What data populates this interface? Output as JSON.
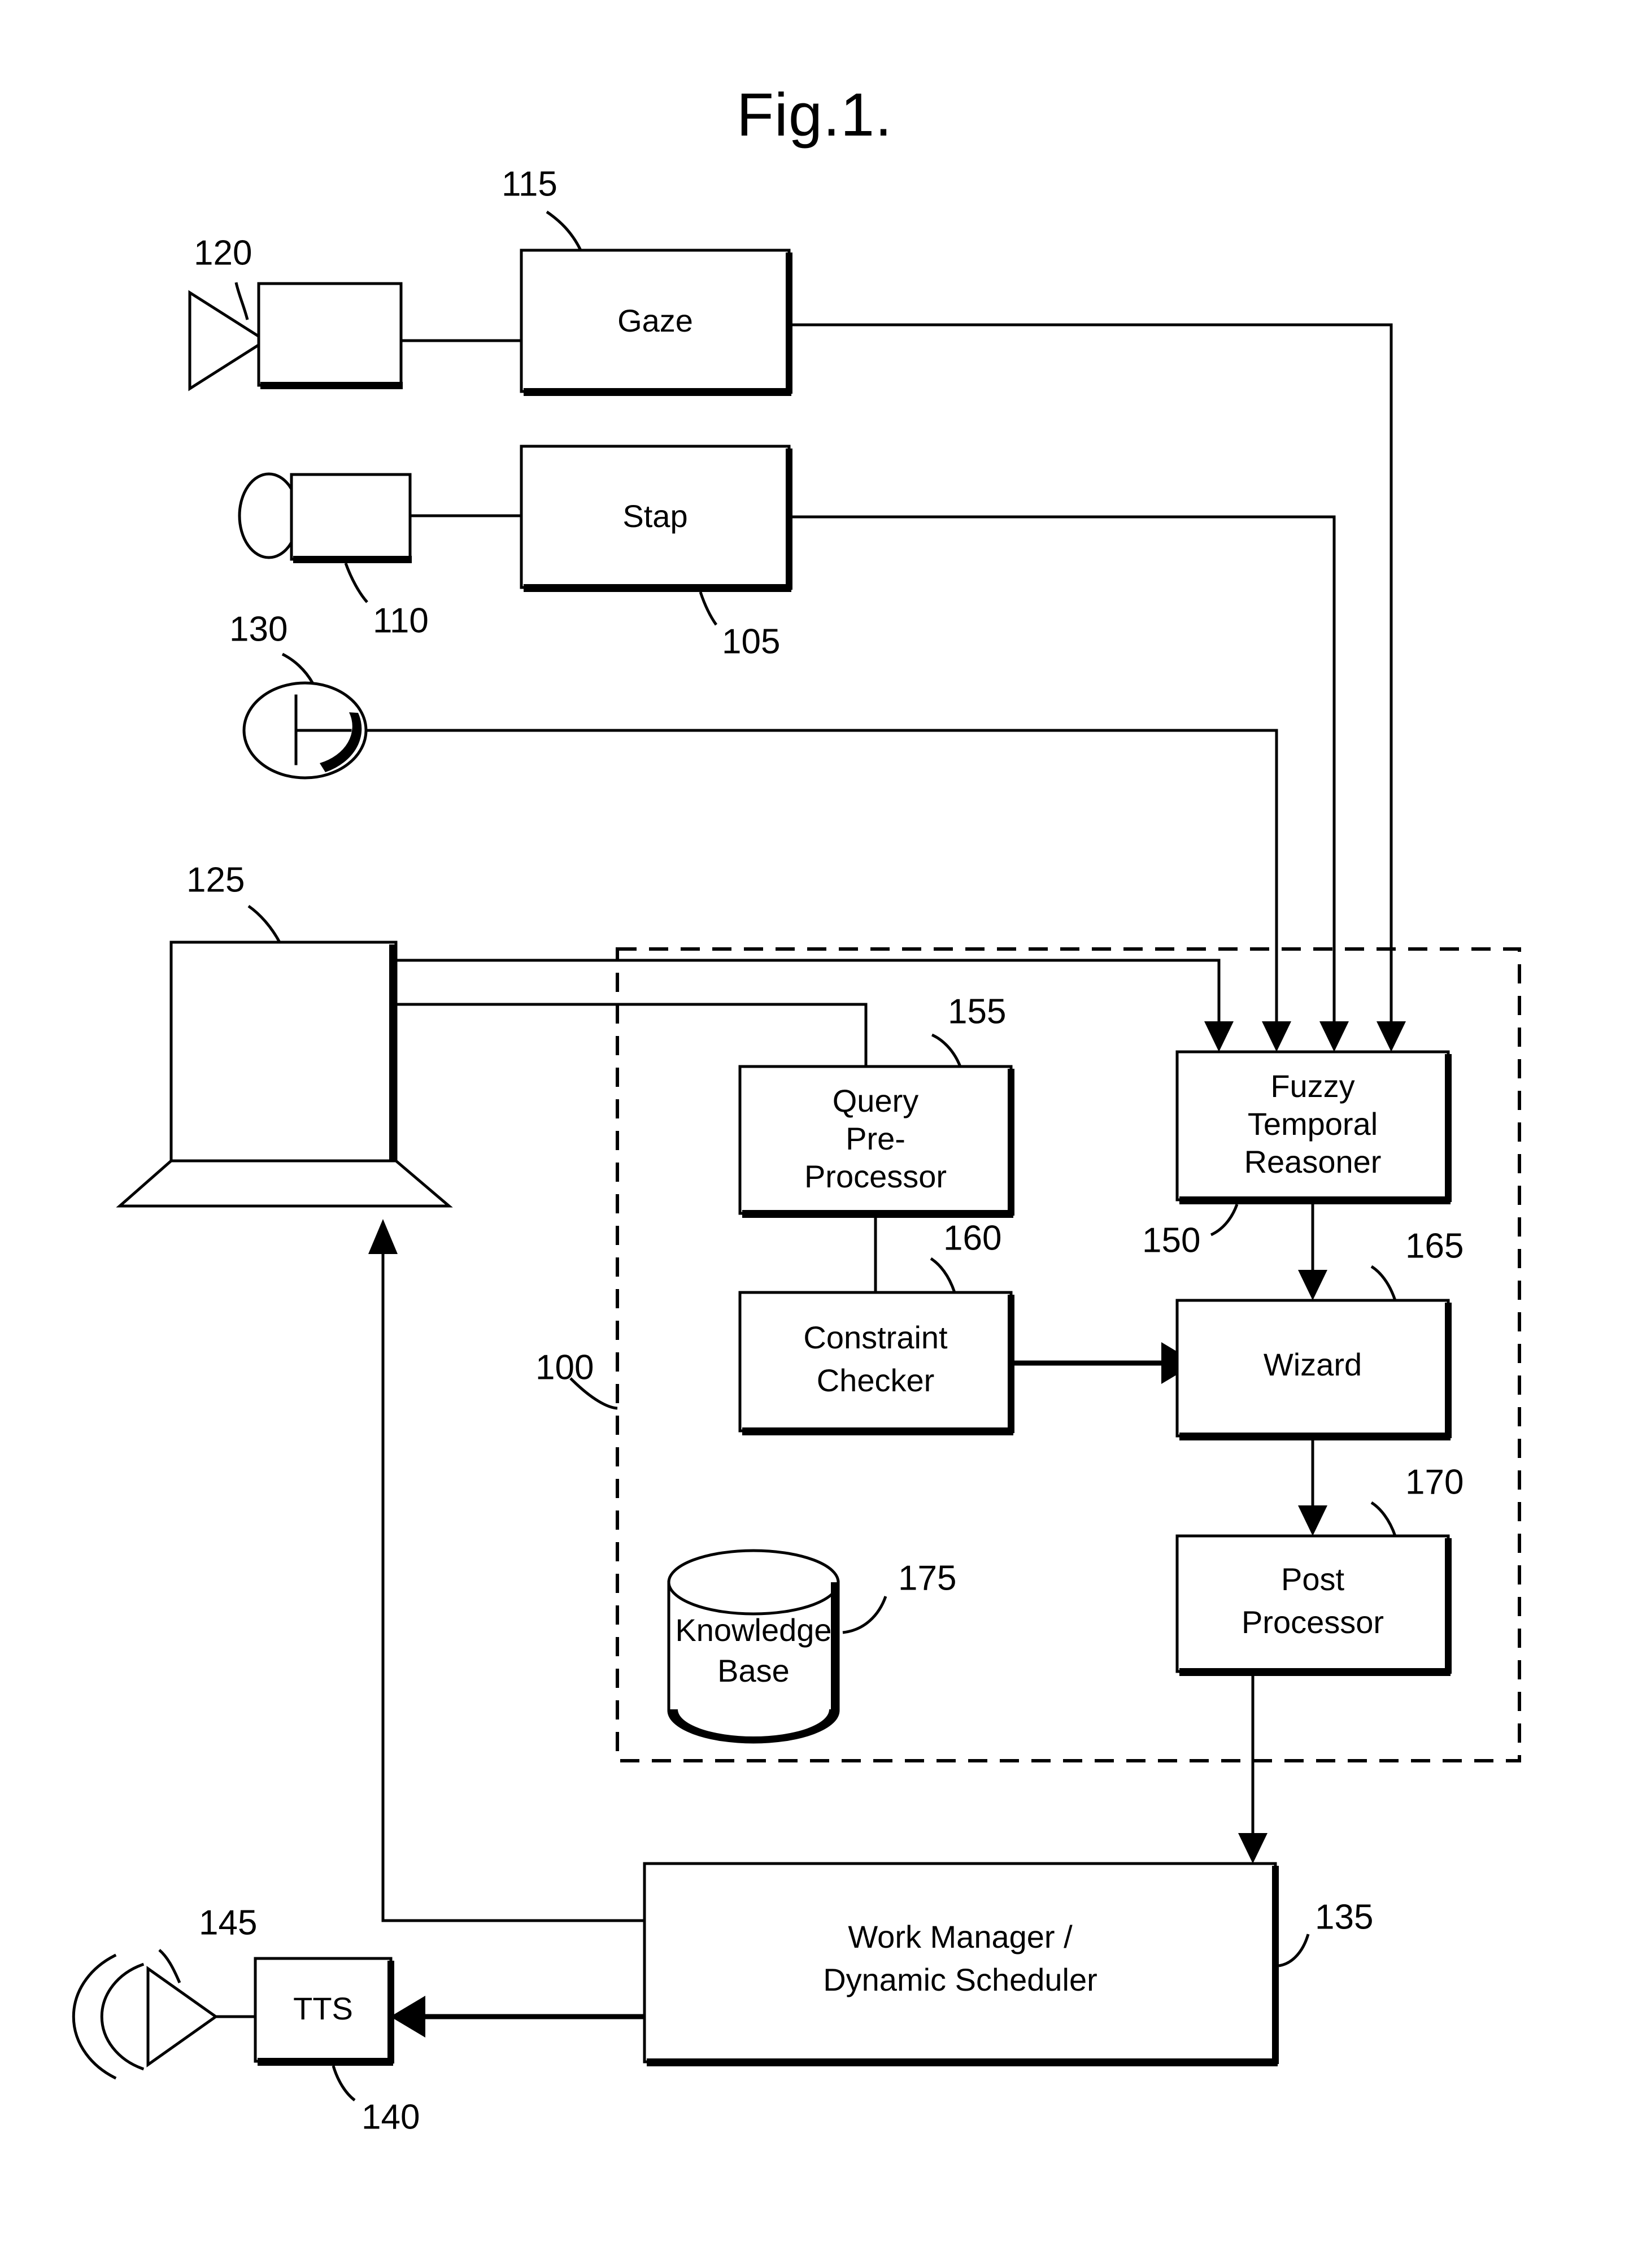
{
  "figure": {
    "title": "Fig.1.",
    "type": "patent-block-diagram"
  },
  "blocks": [
    {
      "id": "gaze",
      "label": "Gaze",
      "ref": "115"
    },
    {
      "id": "stap",
      "label": "Stap",
      "ref": "105"
    },
    {
      "id": "qpp",
      "label": "Query Pre- Processor",
      "ref": "155",
      "lines": [
        "Query",
        "Pre-",
        "Processor"
      ]
    },
    {
      "id": "ftr",
      "label": "Fuzzy Temporal Reasoner",
      "ref": "150",
      "lines": [
        "Fuzzy",
        "Temporal",
        "Reasoner"
      ]
    },
    {
      "id": "cc",
      "label": "Constraint Checker",
      "ref": "160",
      "lines": [
        "Constraint",
        "Checker"
      ]
    },
    {
      "id": "wizard",
      "label": "Wizard",
      "ref": "165",
      "lines": [
        "Wizard"
      ]
    },
    {
      "id": "postproc",
      "label": "Post Processor",
      "ref": "170",
      "lines": [
        "Post",
        "Processor"
      ]
    },
    {
      "id": "kb",
      "label": "Knowledge Base",
      "ref": "175",
      "lines": [
        "Knowledge",
        "Base"
      ]
    },
    {
      "id": "workmgr",
      "label": "Work Manager / Dynamic Scheduler",
      "ref": "135",
      "lines": [
        "Work Manager /",
        "Dynamic Scheduler"
      ]
    },
    {
      "id": "tts",
      "label": "TTS",
      "ref": "140",
      "lines": [
        "TTS"
      ]
    }
  ],
  "devices": [
    {
      "id": "camera",
      "icon": "camera-icon",
      "ref": "120",
      "label": ""
    },
    {
      "id": "microphone",
      "icon": "microphone-icon",
      "ref": "110",
      "label": ""
    },
    {
      "id": "clock",
      "icon": "clock-icon",
      "ref": "130",
      "label": ""
    },
    {
      "id": "laptop",
      "icon": "laptop-icon",
      "ref": "125",
      "label": ""
    },
    {
      "id": "speaker",
      "icon": "speaker-icon",
      "ref": "145",
      "label": ""
    }
  ],
  "system_boundary": {
    "ref": "100",
    "style": "dashed"
  },
  "refs": {
    "r100": "100",
    "r105": "105",
    "r110": "110",
    "r115": "115",
    "r120": "120",
    "r125": "125",
    "r130": "130",
    "r135": "135",
    "r140": "140",
    "r145": "145",
    "r150": "150",
    "r155": "155",
    "r160": "160",
    "r165": "165",
    "r170": "170",
    "r175": "175"
  },
  "labels": {
    "gaze": "Gaze",
    "stap": "Stap",
    "query_l1": "Query",
    "query_l2": "Pre-",
    "query_l3": "Processor",
    "ftr_l1": "Fuzzy",
    "ftr_l2": "Temporal",
    "ftr_l3": "Reasoner",
    "cc_l1": "Constraint",
    "cc_l2": "Checker",
    "wizard": "Wizard",
    "post_l1": "Post",
    "post_l2": "Processor",
    "kb_l1": "Knowledge",
    "kb_l2": "Base",
    "wm_l1": "Work Manager /",
    "wm_l2": "Dynamic Scheduler",
    "tts": "TTS"
  },
  "colors": {
    "ink": "#000000",
    "paper": "#ffffff"
  }
}
